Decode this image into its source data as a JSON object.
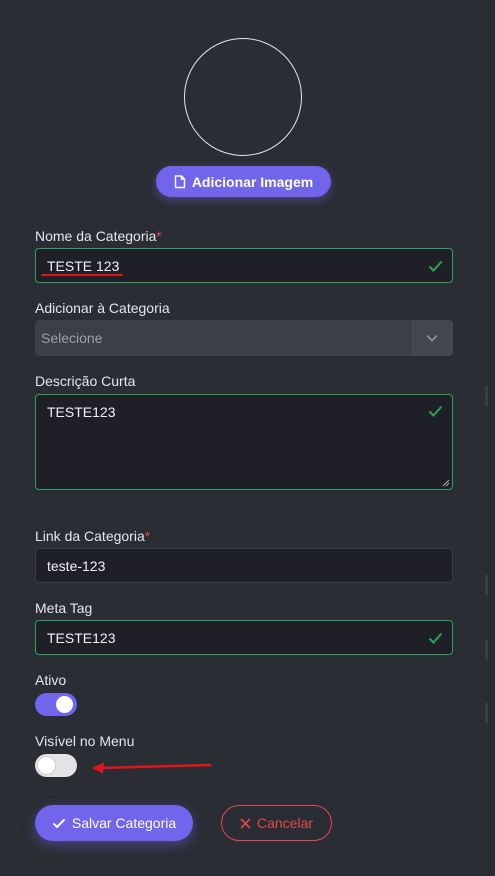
{
  "colors": {
    "accent": "#7165ec",
    "valid": "#27a35b",
    "danger": "#e5484d",
    "annotation": "#e0141a"
  },
  "image": {
    "add_button_label": "Adicionar Imagem",
    "button_icon": "document-icon"
  },
  "fields": {
    "name": {
      "label": "Nome da Categoria",
      "required_mark": "*",
      "value": "TESTE 123"
    },
    "parent": {
      "label": "Adicionar à Categoria",
      "placeholder": "Selecione"
    },
    "short_description": {
      "label": "Descrição Curta",
      "value": "TESTE123"
    },
    "link": {
      "label": "Link da Categoria",
      "required_mark": "*",
      "value": "teste-123"
    },
    "meta_tag": {
      "label": "Meta Tag",
      "value": "TESTE123"
    }
  },
  "toggles": {
    "active": {
      "label": "Ativo",
      "on": true
    },
    "visible_in_menu": {
      "label": "Visível no Menu",
      "on": false
    }
  },
  "actions": {
    "save_label": "Salvar Categoria",
    "cancel_label": "Cancelar"
  }
}
